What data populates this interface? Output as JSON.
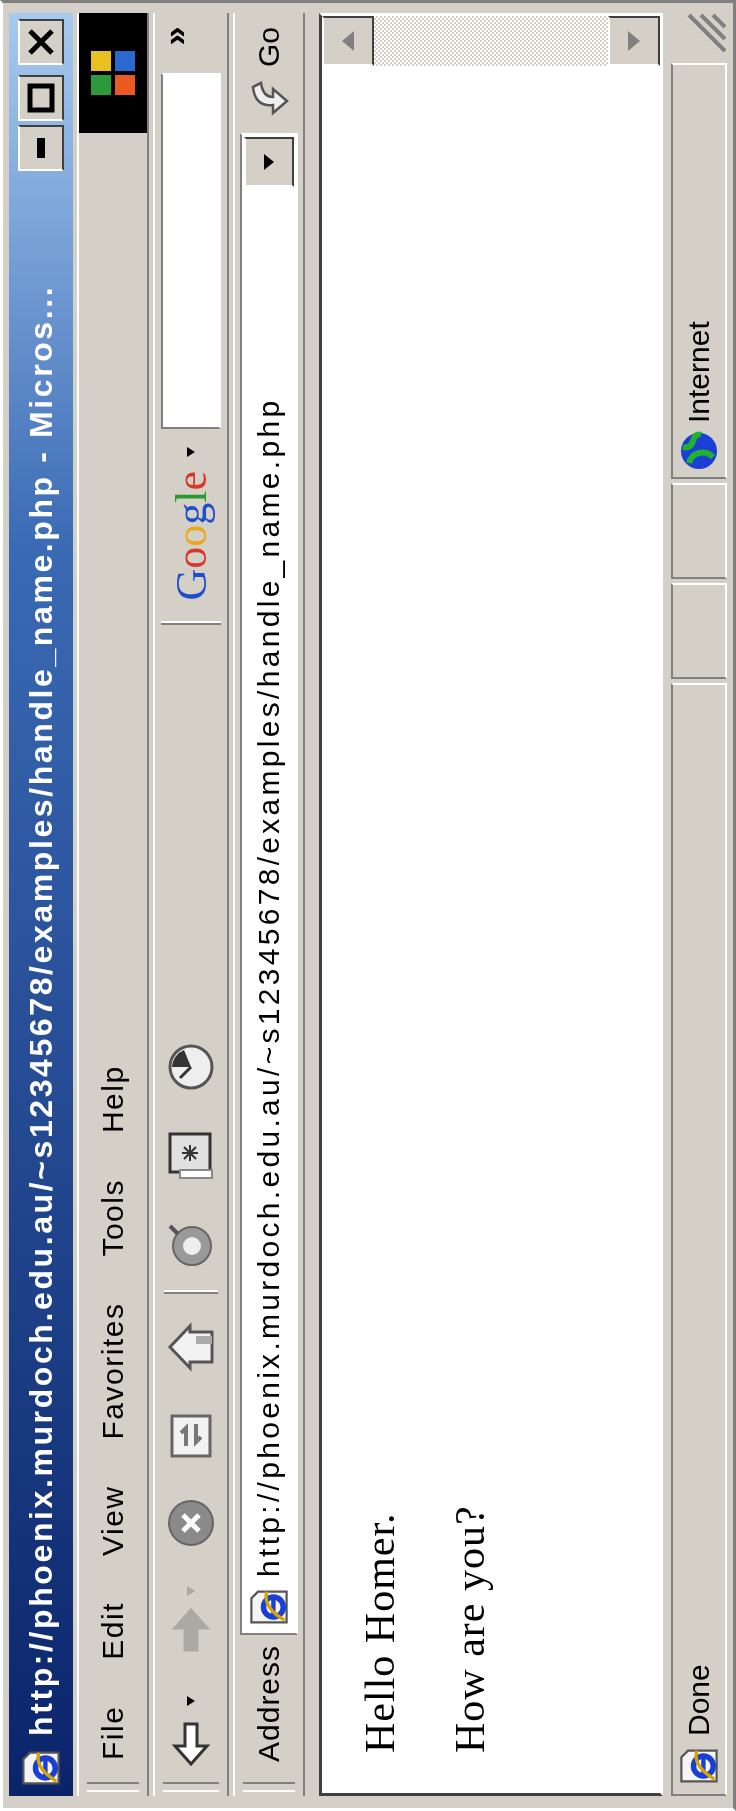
{
  "window": {
    "title": "http://phoenix.murdoch.edu.au/~s12345678/examples/handle_name.php - Micros..."
  },
  "menu": [
    {
      "label": "File"
    },
    {
      "label": "Edit"
    },
    {
      "label": "View"
    },
    {
      "label": "Favorites"
    },
    {
      "label": "Tools"
    },
    {
      "label": "Help"
    }
  ],
  "toolbar": [
    {
      "kind": "back",
      "disabled": false
    },
    {
      "kind": "forward",
      "disabled": true
    },
    {
      "kind": "stop",
      "disabled": false
    },
    {
      "kind": "refresh",
      "disabled": false
    },
    {
      "kind": "home",
      "disabled": false
    },
    {
      "kind": "separator"
    },
    {
      "kind": "search",
      "disabled": false
    },
    {
      "kind": "media",
      "disabled": false
    },
    {
      "kind": "history",
      "disabled": false
    }
  ],
  "google_toolbar": {
    "logo": "Google",
    "chevron": "»"
  },
  "address_bar": {
    "label": "Address",
    "url": "http://phoenix.murdoch.edu.au/~s12345678/examples/handle_name.php",
    "go": "Go"
  },
  "content": {
    "paragraphs": [
      "Hello Homer.",
      "How are you?"
    ]
  },
  "status_bar": {
    "text": "Done",
    "zone": "Internet"
  }
}
